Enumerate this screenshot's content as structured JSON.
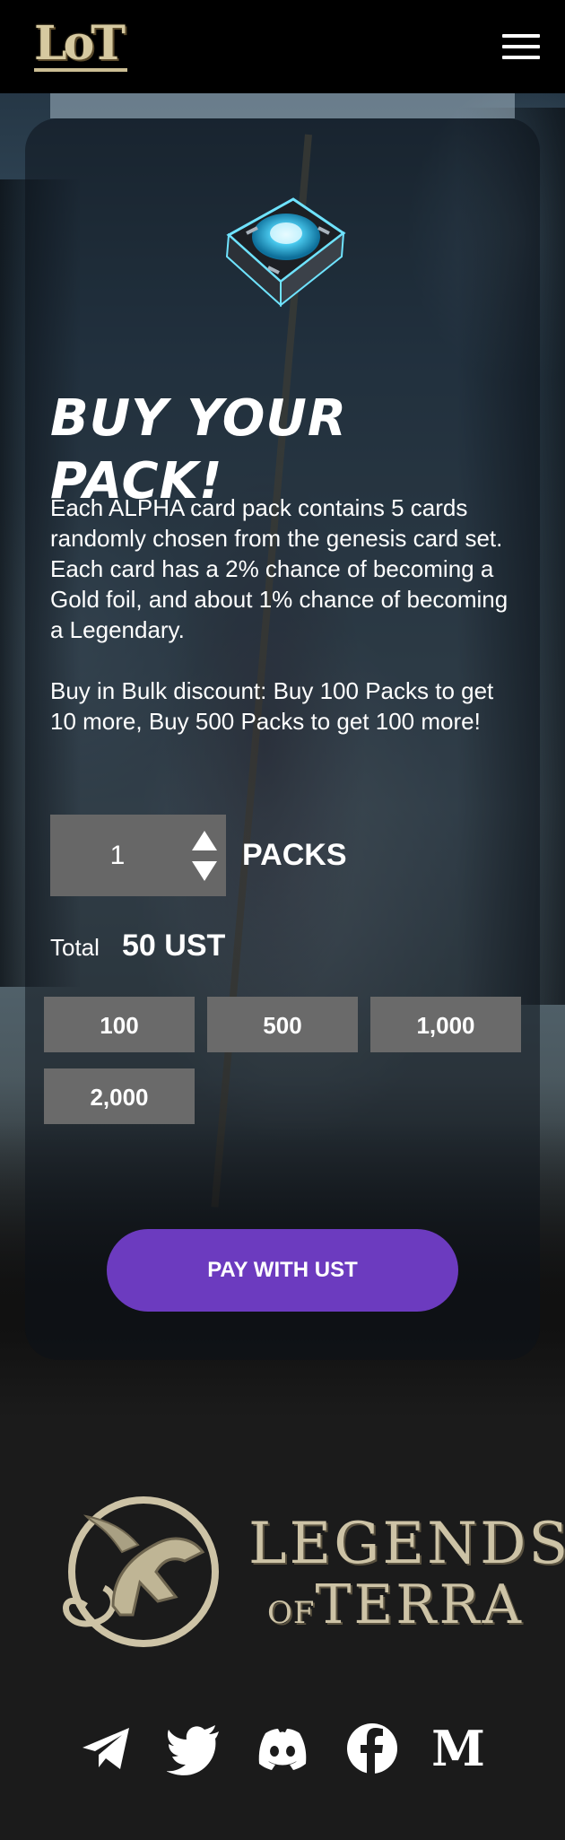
{
  "header": {
    "logo_text": "LoT",
    "menu_icon": "hamburger-menu-icon"
  },
  "pack": {
    "icon": "card-pack-icon",
    "title": "BUY YOUR PACK!",
    "description_1": "Each ALPHA card pack contains 5 cards randomly chosen from the genesis card set. Each card has a 2% chance of becoming a Gold foil, and about 1% chance of becoming a Legendary.",
    "description_2": "Buy in Bulk discount: Buy 100 Packs to get 10 more, Buy 500 Packs to get 100 more!"
  },
  "quantity": {
    "value": "1",
    "unit_label": "PACKS",
    "up_icon": "triangle-up-icon",
    "down_icon": "triangle-down-icon"
  },
  "total": {
    "label": "Total",
    "value": "50 UST"
  },
  "presets": [
    "100",
    "500",
    "1,000",
    "2,000"
  ],
  "pay_button": "PAY WITH UST",
  "footer": {
    "brand_line_1": "LEGENDS",
    "brand_line_2_prefix": "OF",
    "brand_line_2": "TERRA",
    "emblem_icon": "dragon-emblem-icon",
    "social": [
      "telegram-icon",
      "twitter-icon",
      "discord-icon",
      "facebook-icon",
      "medium-icon"
    ]
  },
  "colors": {
    "accent": "#6c3bbf",
    "preset_button": "#6a6a6a",
    "logo_gold": "#d6c9a0"
  }
}
